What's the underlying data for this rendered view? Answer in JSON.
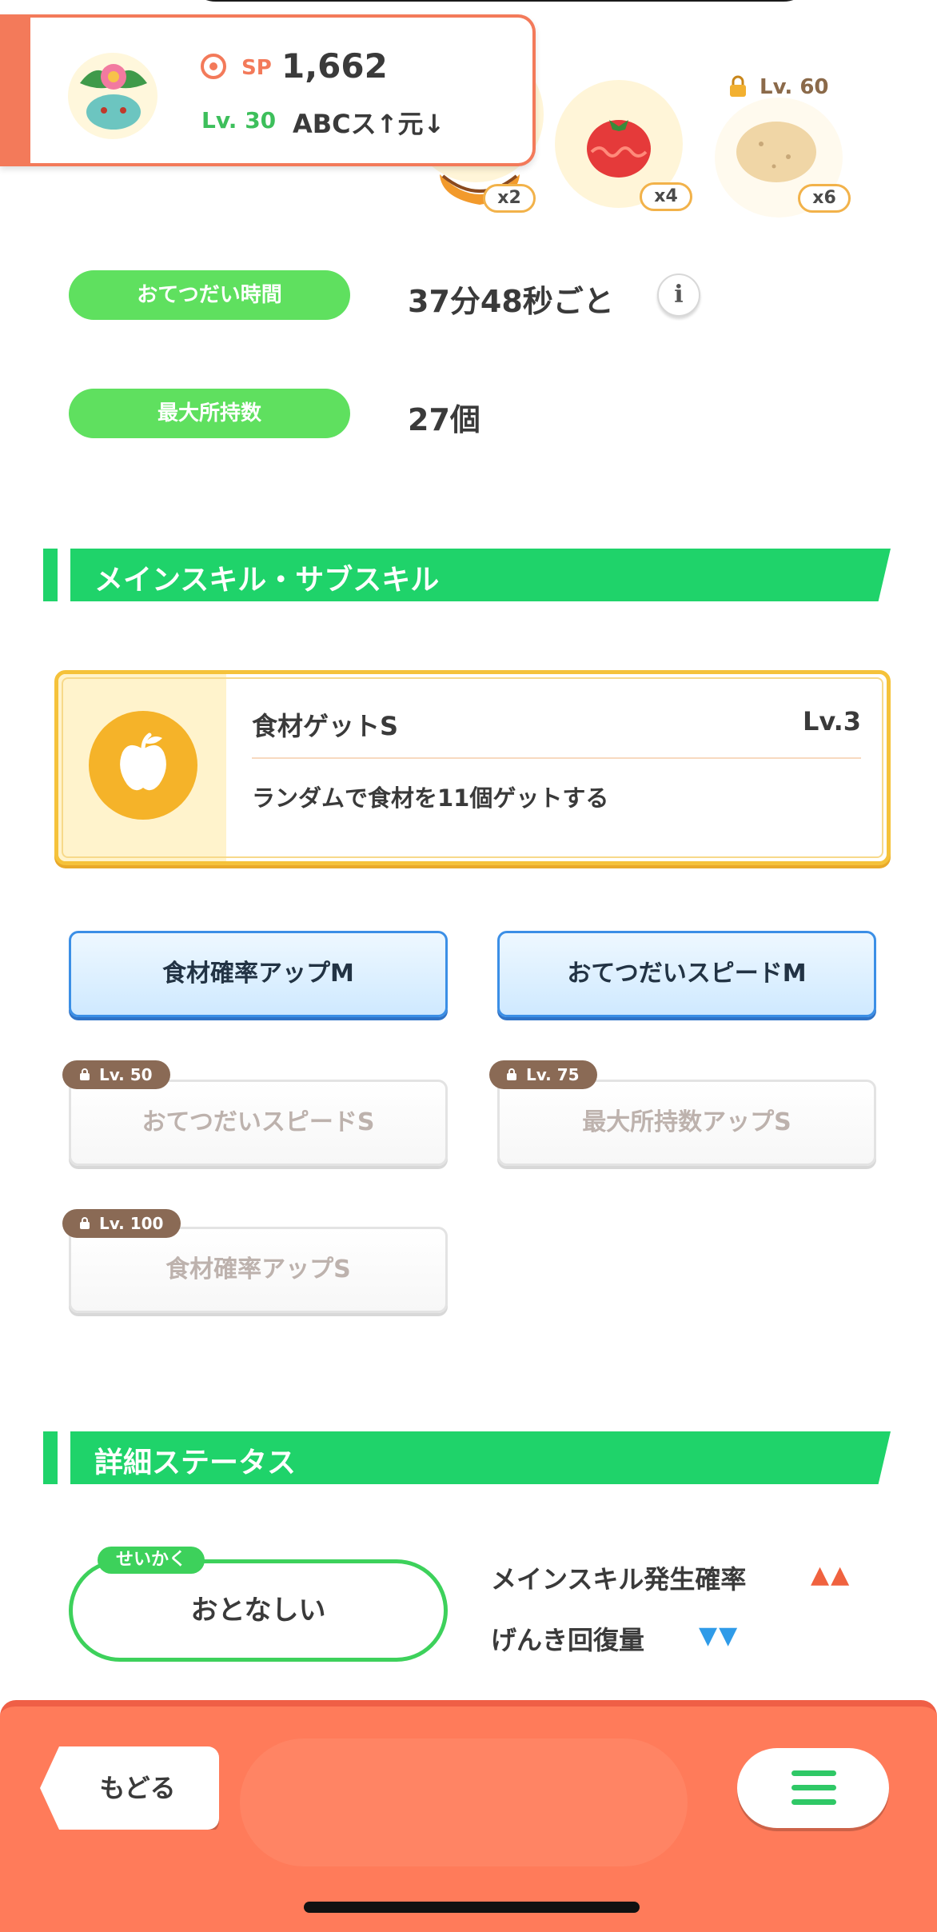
{
  "header": {
    "sp_label": "SP",
    "sp_value": "1,662",
    "level": "Lv. 30",
    "nature_abbrev": "ABCス↑元↓"
  },
  "ingredients": [
    {
      "name": "roasted-item-icon",
      "qty": "x2"
    },
    {
      "name": "tomato-icon",
      "qty": "x4"
    },
    {
      "name": "potato-icon",
      "qty": "x6",
      "locked_level": "Lv. 60"
    }
  ],
  "stats": {
    "help_time_label": "おてつだい時間",
    "help_time_value": "37分48秒ごと",
    "max_carry_label": "最大所持数",
    "max_carry_value": "27個"
  },
  "sections": {
    "skills_title": "メインスキル・サブスキル",
    "details_title": "詳細ステータス"
  },
  "main_skill": {
    "name": "食材ゲットS",
    "level": "Lv.3",
    "description": "ランダムで食材を11個ゲットする"
  },
  "sub_skills": [
    {
      "label": "食材確率アップM",
      "locked": false
    },
    {
      "label": "おてつだいスピードM",
      "locked": false
    },
    {
      "label": "おてつだいスピードS",
      "locked": true,
      "lock_level": "Lv. 50"
    },
    {
      "label": "最大所持数アップS",
      "locked": true,
      "lock_level": "Lv. 75"
    },
    {
      "label": "食材確率アップS",
      "locked": true,
      "lock_level": "Lv. 100"
    }
  ],
  "nature": {
    "tag": "せいかく",
    "name": "おとなしい",
    "up_label": "メインスキル発生確率",
    "up_arrows": "▲▲",
    "down_label": "げんき回復量",
    "down_arrows": "▼▼",
    "up_color": "#f0623f",
    "down_color": "#2f9be8"
  },
  "footer": {
    "back_label": "もどる"
  },
  "colors": {
    "accent_orange": "#f37a5a",
    "accent_green": "#1fd36a",
    "skill_gold": "#f5c23a"
  }
}
